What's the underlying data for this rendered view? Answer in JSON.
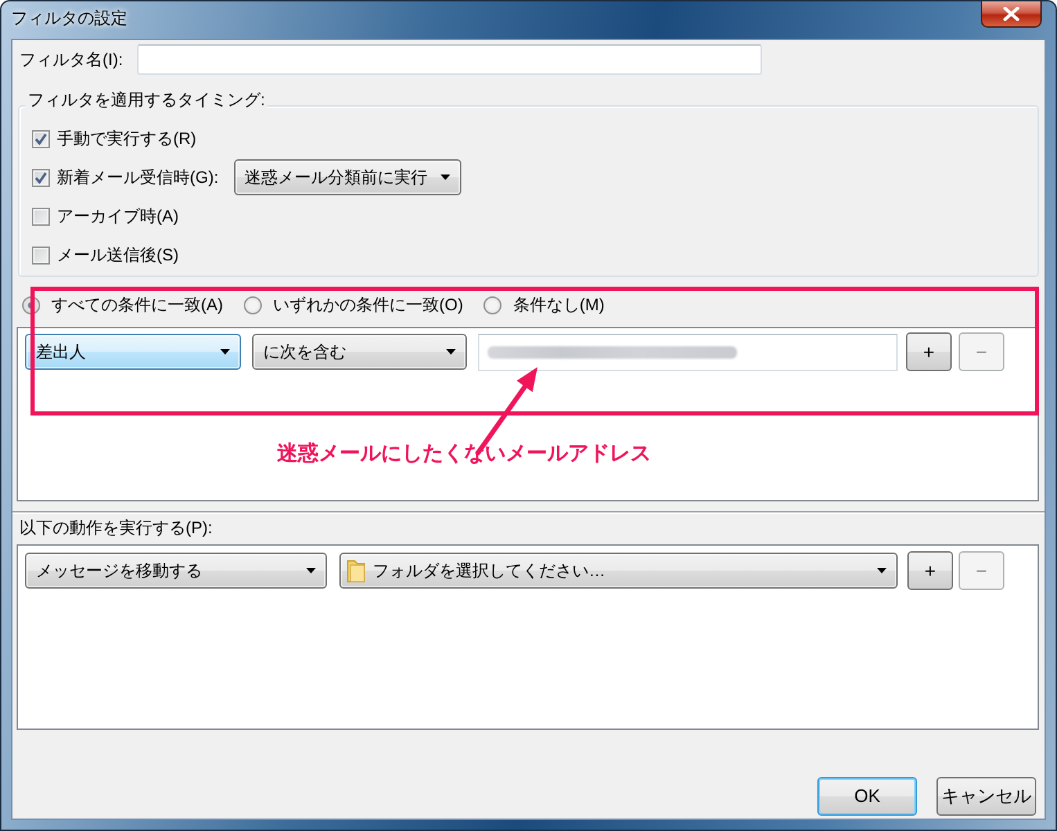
{
  "window": {
    "title": "フィルタの設定"
  },
  "filter_name": {
    "label": "フィルタ名(I):"
  },
  "timing": {
    "title": "フィルタを適用するタイミング:",
    "options": [
      {
        "label": "手動で実行する(R)",
        "checked": true
      },
      {
        "label": "新着メール受信時(G):",
        "checked": true,
        "dropdown": "迷惑メール分類前に実行"
      },
      {
        "label": "アーカイブ時(A)",
        "checked": false
      },
      {
        "label": "メール送信後(S)",
        "checked": false
      }
    ]
  },
  "match": {
    "options": [
      {
        "label": "すべての条件に一致(A)",
        "selected": true
      },
      {
        "label": "いずれかの条件に一致(O)",
        "selected": false
      },
      {
        "label": "条件なし(M)",
        "selected": false
      }
    ],
    "rules": [
      {
        "field": "差出人",
        "field_focused": true,
        "operator": "に次を含む",
        "value_hidden": true,
        "add_button": {
          "label": "+",
          "disabled": false
        },
        "remove_button": {
          "label": "−",
          "disabled": true
        }
      }
    ]
  },
  "actions": {
    "title": "以下の動作を実行する(P):",
    "rows": [
      {
        "action": "メッセージを移動する",
        "target": "フォルダを選択してください…",
        "add_button": {
          "label": "+",
          "disabled": false
        },
        "remove_button": {
          "label": "−",
          "disabled": true
        }
      }
    ]
  },
  "annotation": {
    "text": "迷惑メールにしたくないメールアドレス"
  },
  "buttons": [
    {
      "label": "OK",
      "default": true
    },
    {
      "label": "キャンセル",
      "default": false
    }
  ]
}
